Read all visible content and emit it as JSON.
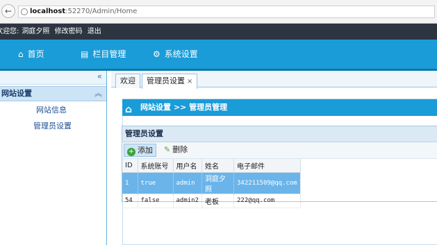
{
  "browser": {
    "url_host": "localhost",
    "url_rest": ":52270/Admin/Home"
  },
  "userbar": {
    "greeting": "欢迎您:",
    "username": "洞庭夕照",
    "change_password": "修改密码",
    "logout": "退出"
  },
  "nav": {
    "items": [
      {
        "label": "首页",
        "icon": "home-icon"
      },
      {
        "label": "栏目管理",
        "icon": "columns-icon"
      },
      {
        "label": "系统设置",
        "icon": "gear-icon"
      }
    ]
  },
  "sidebar": {
    "collapse_glyph": "«",
    "section_title": "网站设置",
    "section_chevron": "︽",
    "links": [
      "网站信息",
      "管理员设置"
    ]
  },
  "tabs": [
    {
      "label": "欢迎"
    },
    {
      "label": "管理员设置",
      "close": "×"
    }
  ],
  "breadcrumb": "网站设置 >> 管理员管理",
  "grid": {
    "title": "管理员设置",
    "toolbar": {
      "add": "添加",
      "delete": "删除"
    },
    "columns": [
      "ID",
      "系统账号",
      "用户名",
      "姓名",
      "电子邮件"
    ],
    "rows": [
      [
        "1",
        "true",
        "admin",
        "洞庭夕照",
        "342211509@qq.com"
      ],
      [
        "54",
        "false",
        "admin2",
        "老板",
        "222@qq.com"
      ]
    ]
  },
  "colors": {
    "nav": "#1a9cd8",
    "selected_row": "#6ab4ea",
    "userbar": "#2c3540"
  }
}
